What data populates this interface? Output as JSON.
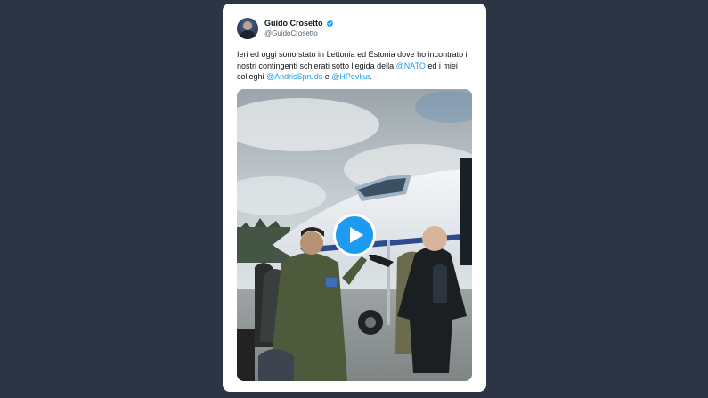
{
  "tweet": {
    "author": {
      "display_name": "Guido Crosetto",
      "handle": "@GuidoCrosetto",
      "verified": true
    },
    "text": {
      "part1": "Ieri ed oggi sono stato in Lettonia ed Estonia dove ho incontrato i nostri contingenti schierati sotto l’egida della ",
      "mention1": "@NATO",
      "part2": " ed i miei colleghi ",
      "mention2": "@AndrisSpruds",
      "part3": " e ",
      "mention3": "@HPevkur",
      "part4": "."
    },
    "media": {
      "type": "video",
      "icon": "play-icon"
    }
  },
  "colors": {
    "background": "#2d3444",
    "card": "#ffffff",
    "link": "#1d9bf0",
    "verified": "#1d9bf0",
    "play_button": "#1d9bf0"
  }
}
